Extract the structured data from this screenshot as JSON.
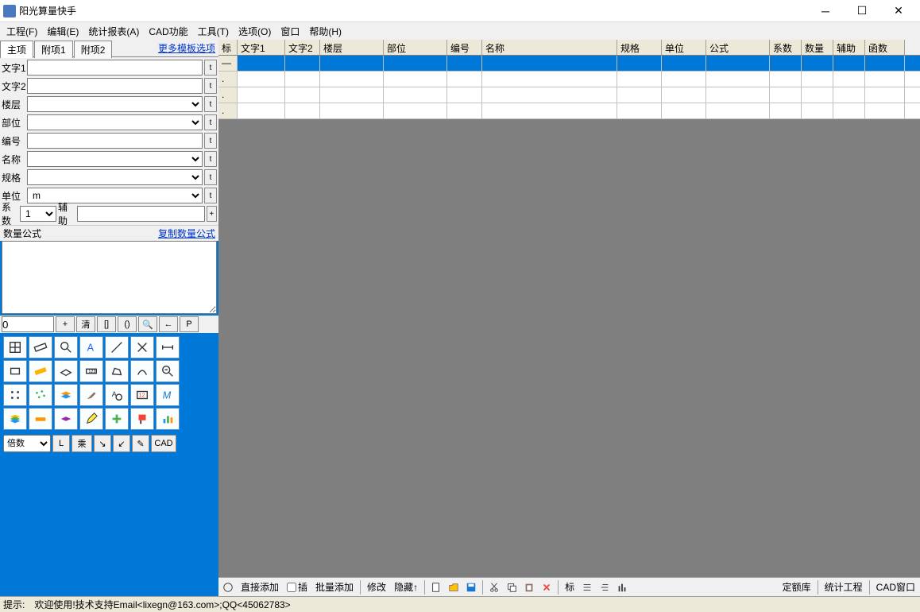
{
  "title": "阳光算量快手",
  "menu": [
    "工程(F)",
    "编辑(E)",
    "统计报表(A)",
    "CAD功能",
    "工具(T)",
    "选项(O)",
    "窗口",
    "帮助(H)"
  ],
  "tabs": [
    "主项",
    "附项1",
    "附项2"
  ],
  "tmpl_link": "更多模板选项",
  "form": {
    "text1_lbl": "文字1",
    "text1_val": "",
    "text2_lbl": "文字2",
    "text2_val": "",
    "floor_lbl": "楼层",
    "floor_val": "",
    "part_lbl": "部位",
    "part_val": "",
    "num_lbl": "编号",
    "num_val": "",
    "name_lbl": "名称",
    "name_val": "",
    "spec_lbl": "规格",
    "spec_val": "",
    "unit_lbl": "单位",
    "unit_val": "m",
    "coef_lbl": "系数",
    "coef_val": "1",
    "aux_lbl": "辅助",
    "aux_val": ""
  },
  "qty": {
    "hdr": "数量公式",
    "copy": "复制数量公式"
  },
  "calc": {
    "in": "0",
    "btns": [
      "+",
      "清",
      "[]",
      "()",
      "🔍",
      "←",
      "P"
    ]
  },
  "bot6": {
    "sel": "倍数",
    "btns": [
      "L",
      "乘",
      "↘",
      "↙",
      "✎",
      "CAD"
    ]
  },
  "tbtn": "t",
  "cols": [
    "标",
    "文字1",
    "文字2",
    "楼层",
    "部位",
    "编号",
    "名称",
    "规格",
    "单位",
    "公式",
    "系数",
    "数量",
    "辅助",
    "函数"
  ],
  "rows": [
    {
      "sel": true,
      "cells": [
        "—",
        "",
        "",
        "",
        "",
        "",
        "",
        "",
        "",
        "",
        "",
        "",
        "",
        ""
      ]
    },
    {
      "sel": false,
      "cells": [
        ".",
        "",
        "",
        "",
        "",
        "",
        "",
        "",
        "",
        "",
        "",
        "",
        "",
        ""
      ]
    },
    {
      "sel": false,
      "cells": [
        ".",
        "",
        "",
        "",
        "",
        "",
        "",
        "",
        "",
        "",
        "",
        "",
        "",
        ""
      ]
    },
    {
      "sel": false,
      "cells": [
        ".",
        "",
        "",
        "",
        "",
        "",
        "",
        "",
        "",
        "",
        "",
        "",
        "",
        ""
      ]
    }
  ],
  "rtb": {
    "add": "直接添加",
    "ins": "插",
    "batch": "批量添加",
    "mod": "修改",
    "hide": "隐藏↑",
    "label": "标",
    "right": [
      "定额库",
      "统计工程",
      "CAD窗口"
    ]
  },
  "status": {
    "lbl": "提示:",
    "msg": "欢迎使用!技术支持Email<lixegn@163.com>;QQ<45062783>"
  }
}
